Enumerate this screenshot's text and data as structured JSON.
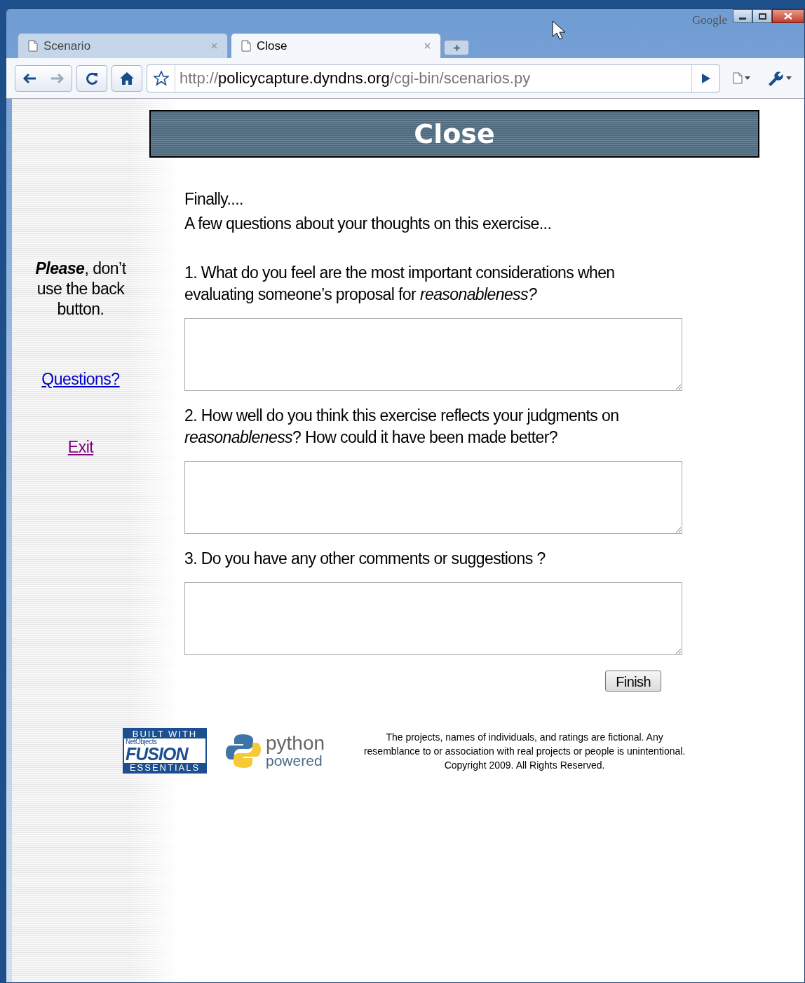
{
  "browser": {
    "brand": "Google",
    "tabs": [
      {
        "label": "Scenario",
        "selected": false
      },
      {
        "label": "Close",
        "selected": true
      }
    ],
    "address": {
      "scheme": "http://",
      "host": "policycapture.dyndns.org",
      "path": "/cgi-bin/scenarios.py"
    }
  },
  "page": {
    "title": "Close",
    "sidebar": {
      "note": "**Please**, don’t use the back button.",
      "links": [
        {
          "label": "Questions?",
          "visited": false
        },
        {
          "label": "Exit",
          "visited": true
        }
      ]
    },
    "intro": [
      "Finally....",
      "A few questions about your thoughts on this exercise..."
    ],
    "questions": [
      {
        "text": "1. What do you feel are the most important considerations when evaluating someone’s proposal for *reasonableness?*"
      },
      {
        "text": "2. How well do you think this exercise reflects your judgments on *reasonableness*?  How could it have been made better?"
      },
      {
        "text": "3. Do you have any other comments or suggestions ?"
      }
    ],
    "submit": "Finish",
    "badges": {
      "fusion": [
        "BUILT WITH",
        "NetObjects",
        "FUSION",
        "ESSENTIALS"
      ],
      "python": [
        "python",
        "powered"
      ]
    },
    "disclaimer": "The projects, names of individuals, and ratings are fictional. Any resemblance to or association with real projects or people is unintentional. Copyright 2009. All Rights Reserved."
  }
}
